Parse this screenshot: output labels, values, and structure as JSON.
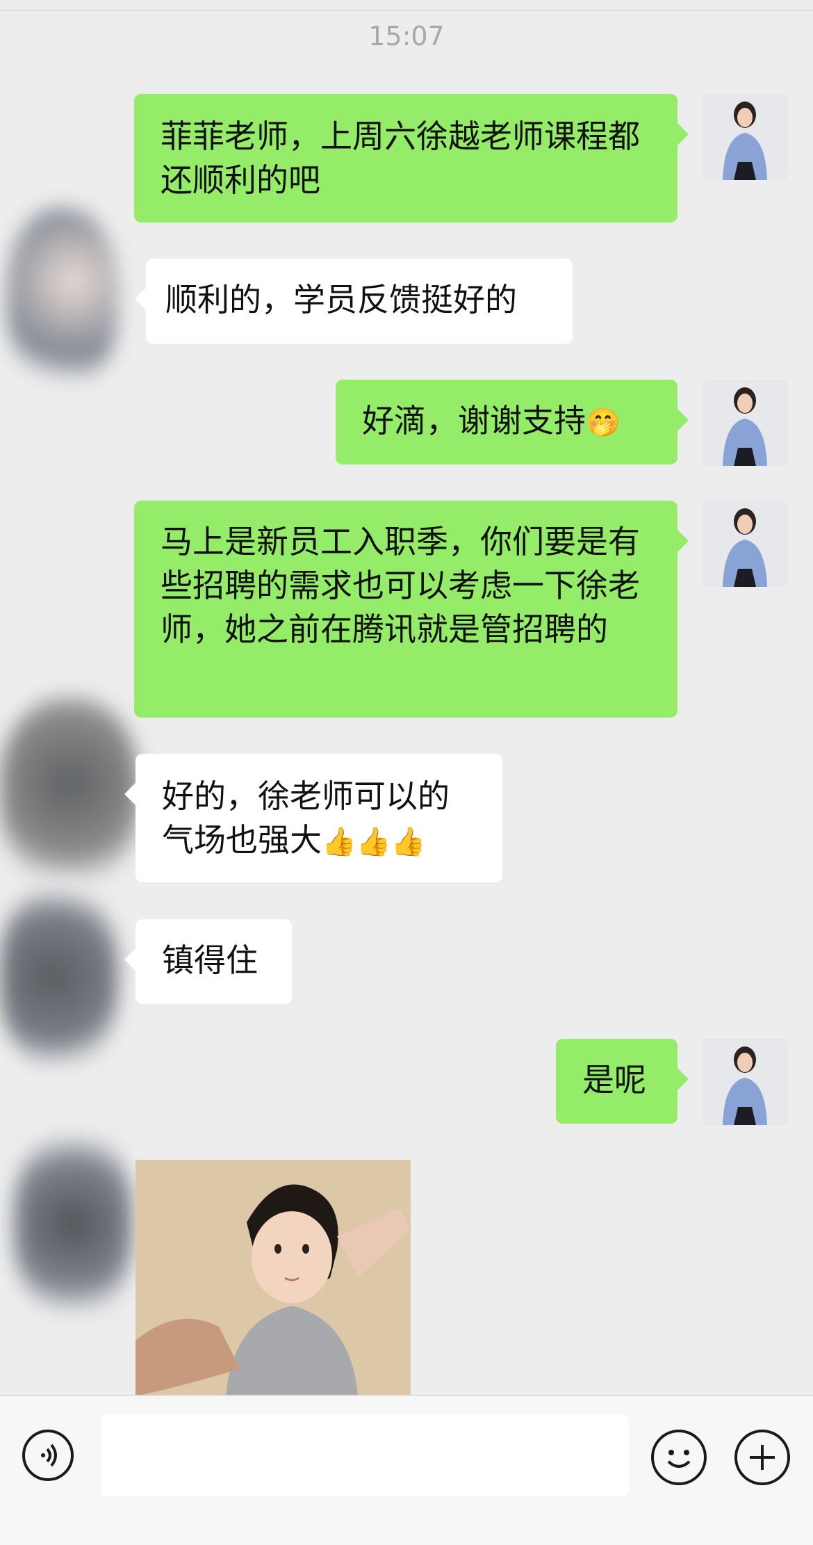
{
  "time": "15:07",
  "messages": [
    {
      "text": "菲菲老师，上周六徐越老师课程都还顺利的吧"
    },
    {
      "text": "顺利的，学员反馈挺好的"
    },
    {
      "text": "好滴，谢谢支持"
    },
    {
      "text": "马上是新员工入职季，你们要是有些招聘的需求也可以考虑一下徐老师，她之前在腾讯就是管招聘的"
    },
    {
      "text": "好的，徐老师可以的气场也强大"
    },
    {
      "text": "镇得住"
    },
    {
      "text": "是呢"
    }
  ],
  "emojis": {
    "smirk": "🤭",
    "thumbs_up": "👍"
  },
  "icons": {
    "voice": "voice-icon",
    "emoji": "emoji-icon",
    "add": "plus-icon"
  },
  "colors": {
    "outgoing_bubble": "#95ec69",
    "incoming_bubble": "#ffffff",
    "background": "#ededed"
  }
}
